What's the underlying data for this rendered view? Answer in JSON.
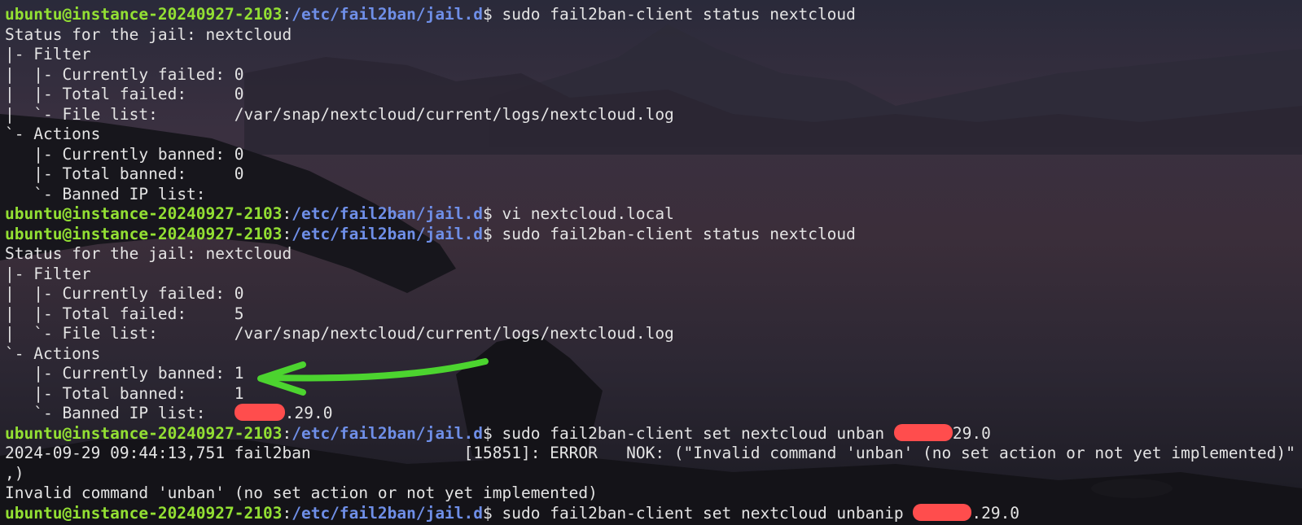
{
  "prompt": {
    "user_host": "ubuntu@instance-20240927-2103",
    "path": "/etc/fail2ban/jail.d",
    "symbol": "$"
  },
  "lines": [
    {
      "type": "cmd",
      "text": " sudo fail2ban-client status nextcloud"
    },
    {
      "type": "out",
      "text": "Status for the jail: nextcloud"
    },
    {
      "type": "out",
      "text": "|- Filter"
    },
    {
      "type": "out",
      "text": "|  |- Currently failed: 0"
    },
    {
      "type": "out",
      "text": "|  |- Total failed:     0"
    },
    {
      "type": "out",
      "text": "|  `- File list:        /var/snap/nextcloud/current/logs/nextcloud.log"
    },
    {
      "type": "out",
      "text": "`- Actions"
    },
    {
      "type": "out",
      "text": "   |- Currently banned: 0"
    },
    {
      "type": "out",
      "text": "   |- Total banned:     0"
    },
    {
      "type": "out",
      "text": "   `- Banned IP list:"
    },
    {
      "type": "cmd",
      "text": " vi nextcloud.local"
    },
    {
      "type": "cmd",
      "text": " sudo fail2ban-client status nextcloud"
    },
    {
      "type": "out",
      "text": "Status for the jail: nextcloud"
    },
    {
      "type": "out",
      "text": "|- Filter"
    },
    {
      "type": "out",
      "text": "|  |- Currently failed: 0"
    },
    {
      "type": "out",
      "text": "|  |- Total failed:     5"
    },
    {
      "type": "out",
      "text": "|  `- File list:        /var/snap/nextcloud/current/logs/nextcloud.log"
    },
    {
      "type": "out",
      "text": "`- Actions"
    },
    {
      "type": "out",
      "text": "   |- Currently banned: 1"
    },
    {
      "type": "out",
      "text": "   |- Total banned:     1"
    },
    {
      "type": "redact",
      "before": "   `- Banned IP list:   ",
      "after": ".29.0",
      "short": true
    },
    {
      "type": "cmdredact",
      "before": " sudo fail2ban-client set nextcloud unban ",
      "after": "29.0"
    },
    {
      "type": "out",
      "text": "2024-09-29 09:44:13,751 fail2ban                [15851]: ERROR   NOK: (\"Invalid command 'unban' (no set action or not yet implemented)\""
    },
    {
      "type": "out",
      "text": ",)"
    },
    {
      "type": "out",
      "text": "Invalid command 'unban' (no set action or not yet implemented)"
    },
    {
      "type": "cmdredact",
      "before": " sudo fail2ban-client set nextcloud unbanip ",
      "after": ".29.0"
    }
  ],
  "annotation": {
    "color": "#4cd42f",
    "points_to": "Currently banned: 1"
  },
  "colors": {
    "user": "#93e033",
    "path": "#6f8fe8",
    "redact": "#ff4d4d"
  }
}
